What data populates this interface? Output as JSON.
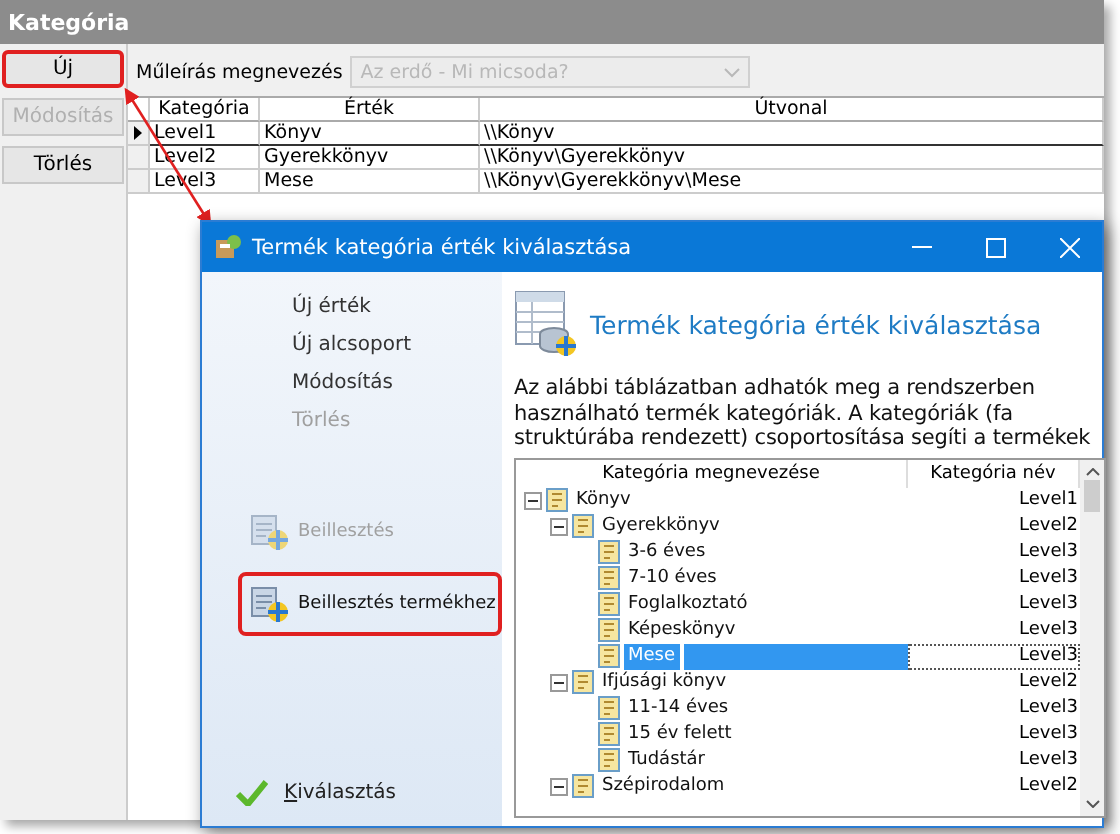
{
  "main_window": {
    "title": "Kategória",
    "buttons": [
      {
        "label": "Új",
        "disabled": false,
        "highlighted": true
      },
      {
        "label": "Módosítás",
        "disabled": true,
        "highlighted": false
      },
      {
        "label": "Törlés",
        "disabled": false,
        "highlighted": false
      }
    ],
    "filter": {
      "label": "Műleírás megnevezés",
      "placeholder": "Az erdő - Mi micsoda?",
      "disabled": true
    },
    "table": {
      "columns": [
        "Kategória",
        "Érték",
        "Útvonal"
      ],
      "rows": [
        {
          "cells": [
            "Level1",
            "Könyv",
            "\\\\Könyv"
          ],
          "current": true
        },
        {
          "cells": [
            "Level2",
            "Gyerekkönyv",
            "\\\\Könyv\\Gyerekkönyv"
          ],
          "current": false
        },
        {
          "cells": [
            "Level3",
            "Mese",
            "\\\\Könyv\\Gyerekkönyv\\Mese"
          ],
          "current": false
        }
      ]
    }
  },
  "dialog": {
    "title": "Termék kategória érték kiválasztása",
    "actions": [
      {
        "label": "Új érték",
        "disabled": false
      },
      {
        "label": "Új alcsoport",
        "disabled": false
      },
      {
        "label": "Módosítás",
        "disabled": false
      },
      {
        "label": "Törlés",
        "disabled": true
      }
    ],
    "paste_actions": [
      {
        "label": "Beillesztés",
        "disabled": true,
        "highlighted": false
      },
      {
        "label": "Beillesztés termékhez",
        "disabled": false,
        "highlighted": true
      }
    ],
    "confirm": {
      "label": "Kiválasztás"
    },
    "heading": "Termék kategória érték kiválasztása",
    "description": "Az alábbi táblázatban adhatók meg a rendszerben használható termék kategóriák. A kategóriák (fa struktúrába rendezett) csoportosítása segíti a termékek",
    "tree": {
      "columns": [
        "Kategória megnevezése",
        "Kategória név"
      ],
      "items": [
        {
          "name": "Könyv",
          "level": "Level1",
          "selected": false,
          "expanded": true,
          "children": [
            {
              "name": "Gyerekkönyv",
              "level": "Level2",
              "selected": false,
              "expanded": true,
              "children": [
                {
                  "name": "3-6 éves",
                  "level": "Level3",
                  "selected": false
                },
                {
                  "name": "7-10 éves",
                  "level": "Level3",
                  "selected": false
                },
                {
                  "name": "Foglalkoztató",
                  "level": "Level3",
                  "selected": false
                },
                {
                  "name": "Képeskönyv",
                  "level": "Level3",
                  "selected": false
                },
                {
                  "name": "Mese",
                  "level": "Level3",
                  "selected": true
                }
              ]
            },
            {
              "name": "Ifjúsági könyv",
              "level": "Level2",
              "selected": false,
              "expanded": true,
              "children": [
                {
                  "name": "11-14 éves",
                  "level": "Level3",
                  "selected": false
                },
                {
                  "name": "15 év felett",
                  "level": "Level3",
                  "selected": false
                },
                {
                  "name": "Tudástár",
                  "level": "Level3",
                  "selected": false
                }
              ]
            },
            {
              "name": "Szépirodalom",
              "level": "Level2",
              "selected": false,
              "expanded": true
            }
          ]
        }
      ]
    }
  }
}
